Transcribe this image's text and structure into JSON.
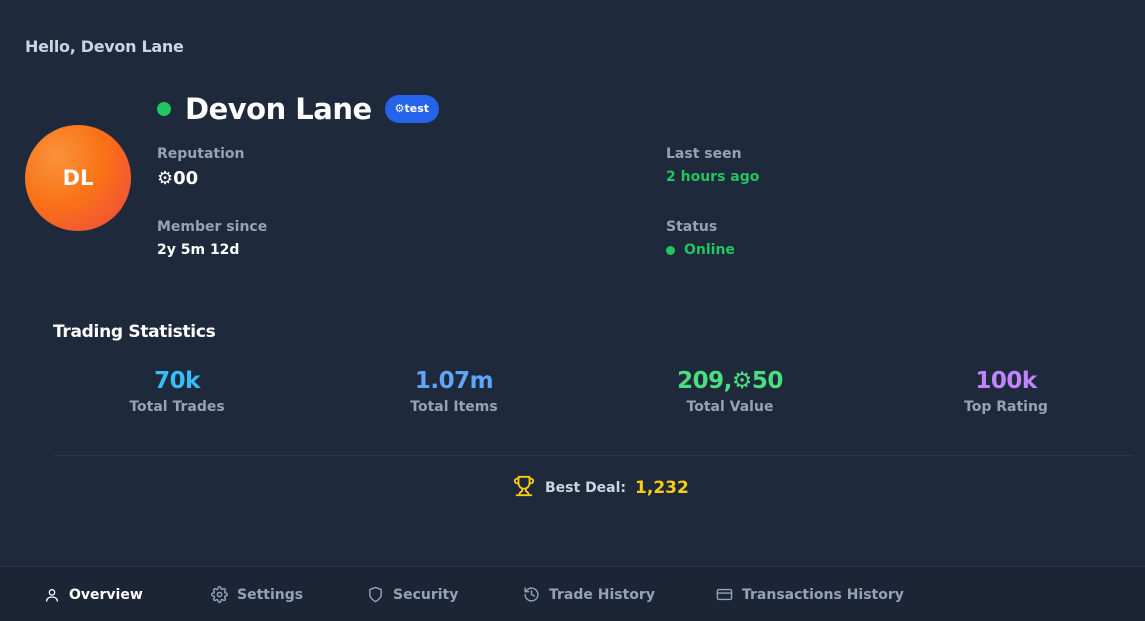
{
  "greeting": "Hello, Devon Lane",
  "profile": {
    "initials": "DL",
    "name": "Devon Lane",
    "badge": "⚙test",
    "online_color": "#22c55e"
  },
  "info": {
    "reputation_label": "Reputation",
    "reputation_value": "⚙00",
    "last_seen_label": "Last seen",
    "last_seen_value": "2 hours ago",
    "member_since_label": "Member since",
    "member_since_value": "2y 5m 12d",
    "status_label": "Status",
    "status_value": "Online"
  },
  "stats": {
    "title": "Trading Statistics",
    "items": [
      {
        "value": "70k",
        "label": "Total Trades",
        "color": "#38bdf8"
      },
      {
        "value": "1.07m",
        "label": "Total Items",
        "color": "#60a5fa"
      },
      {
        "value": "209,⚙50",
        "label": "Total Value",
        "color": "#4ade80"
      },
      {
        "value": "100k",
        "label": "Top Rating",
        "color": "#c084fc"
      }
    ]
  },
  "best_deal": {
    "icon": "trophy-icon",
    "label": "Best Deal:",
    "value": "1,232",
    "color": "#facc15"
  },
  "tabs": [
    {
      "label": "Overview",
      "icon": "user-icon",
      "active": true
    },
    {
      "label": "Settings",
      "icon": "gear-icon",
      "active": false
    },
    {
      "label": "Security",
      "icon": "shield-icon",
      "active": false
    },
    {
      "label": "Trade History",
      "icon": "history-icon",
      "active": false
    },
    {
      "label": "Transactions History",
      "icon": "credit-card-icon",
      "active": false
    }
  ]
}
